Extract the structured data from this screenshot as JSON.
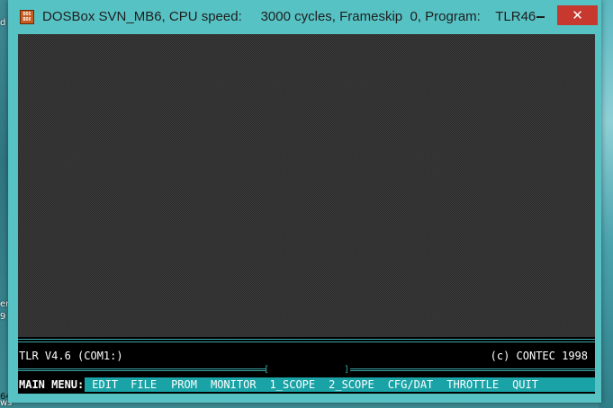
{
  "desktop": {
    "left_fragments": [
      "d",
      "er",
      "9",
      "64",
      "ws"
    ],
    "colors": {
      "window_frame": "#57c2c4",
      "close_button": "#c7382f",
      "dos_menu": "#1aa3a6"
    }
  },
  "window": {
    "icon_text": "DOS BOX",
    "title": "DOSBox SVN_MB6, CPU speed:     3000 cycles, Frameskip  0, Program:    TLR46",
    "close_glyph": "✕"
  },
  "dos": {
    "status_left": "TLR V4.6 (COM1:)",
    "status_right": "(c) CONTEC 1998",
    "bracket_left": "[",
    "bracket_right": "]",
    "menu_label": "MAIN MENU:",
    "menu_items": [
      "EDIT",
      "FILE",
      "PROM",
      "MONITOR",
      "1_SCOPE",
      "2_SCOPE",
      "CFG/DAT",
      "THROTTLE",
      "QUIT"
    ]
  }
}
